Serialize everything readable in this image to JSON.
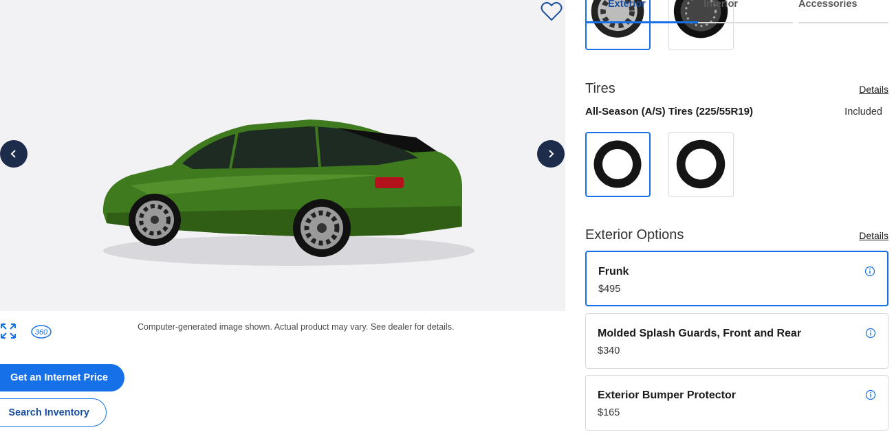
{
  "viewer": {
    "disclaimer": "Computer-generated image shown. Actual product may vary. See dealer for details.",
    "tool_360_label": "360"
  },
  "actions": {
    "internet_price": "Get an Internet Price",
    "search_inventory": "Search Inventory"
  },
  "tabs": [
    {
      "label": "Exterior",
      "active": true
    },
    {
      "label": "Interior",
      "active": false
    },
    {
      "label": "Accessories",
      "active": false
    }
  ],
  "tires": {
    "title": "Tires",
    "details_label": "Details",
    "selected_name": "All-Season (A/S) Tires (225/55R19)",
    "status": "Included"
  },
  "exterior_options": {
    "title": "Exterior Options",
    "details_label": "Details",
    "items": [
      {
        "name": "Frunk",
        "price": "$495",
        "selected": true
      },
      {
        "name": "Molded Splash Guards, Front and Rear",
        "price": "$340",
        "selected": false
      },
      {
        "name": "Exterior Bumper Protector",
        "price": "$165",
        "selected": false
      }
    ]
  },
  "colors": {
    "accent": "#1670e8",
    "nav_button": "#1c2c4a",
    "car_body": "#3f7a1e",
    "viewer_bg": "#f2f2f4"
  },
  "icons": {
    "favorite": "heart-outline-icon",
    "prev": "chevron-left-icon",
    "next": "chevron-right-icon",
    "expand": "expand-arrows-icon",
    "rotate": "360-view-icon",
    "info": "info-circle-icon"
  }
}
